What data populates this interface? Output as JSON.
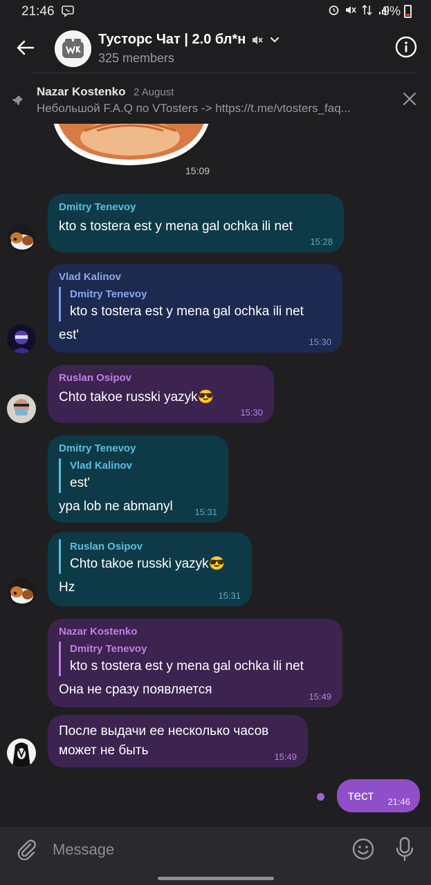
{
  "status_bar": {
    "time": "21:46",
    "battery": "9%"
  },
  "header": {
    "title": "Тусторс Чат | 2.0 бл*н",
    "members": "325 members"
  },
  "pinned": {
    "author": "Nazar Kostenko",
    "date": "2 August",
    "text": "Небольшой F.A.Q по VTosters -> https://t.me/vtosters_faq..."
  },
  "sticker": {
    "time": "15:09"
  },
  "messages": [
    {
      "author": "Dmitry Tenevoy",
      "text": "kto s tostera est y mena gal ochka ili net",
      "time": "15:28"
    },
    {
      "author": "Vlad Kalinov",
      "quote_author": "Dmitry Tenevoy",
      "quote_text": "kto s tostera est y mena gal ochka ili net",
      "text": "est'",
      "time": "15:30"
    },
    {
      "author": "Ruslan Osipov",
      "text": "Chto takoe russki yazyk😎",
      "time": "15:30"
    },
    {
      "author": "Dmitry Tenevoy",
      "quote_author": "Vlad Kalinov",
      "quote_text": "est'",
      "text": "ypa lob ne abmanyl",
      "time": "15:31"
    },
    {
      "quote_author": "Ruslan Osipov",
      "quote_text": "Chto takoe russki yazyk😎",
      "text": "Hz",
      "time": "15:31"
    },
    {
      "author": "Nazar Kostenko",
      "quote_author": "Dmitry Tenevoy",
      "quote_text": "kto s tostera est y mena gal ochka ili net",
      "text": "Она не сразу появляется",
      "time": "15:49"
    },
    {
      "text_line1": "После выдачи ее несколько часов",
      "text_line2": "может не быть",
      "time": "15:49"
    },
    {
      "text": "тест",
      "time": "21:46"
    }
  ],
  "input": {
    "placeholder": "Message"
  },
  "colors": {
    "background": "#1f1f21",
    "bubble_teal": "#0e3a47",
    "bubble_navy": "#1c2a50",
    "bubble_purple": "#3d2350",
    "bubble_outgoing": "#8f4fc9"
  }
}
